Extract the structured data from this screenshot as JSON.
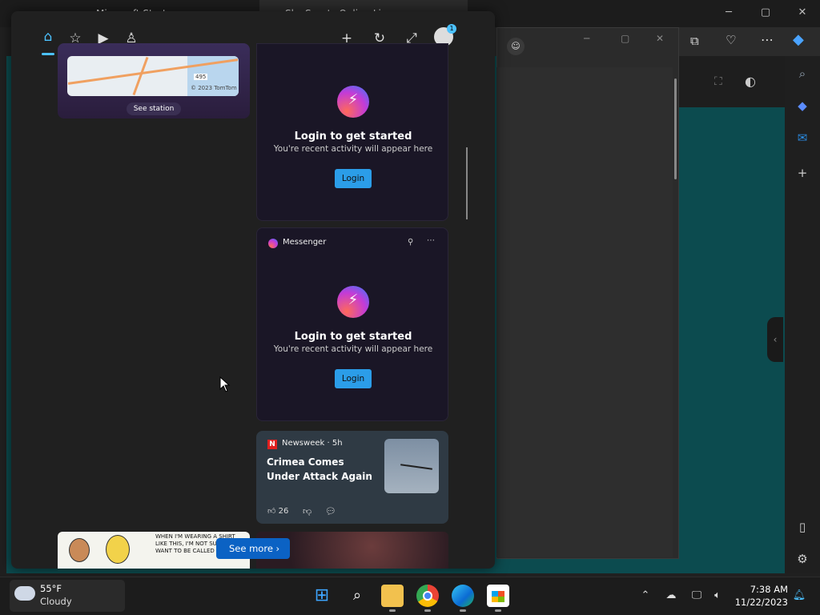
{
  "browser": {
    "tab1_title": "Microsoft Start",
    "tab2_title": "Sky Sports Online Live",
    "minimize": "─",
    "maximize": "▢",
    "close": "✕",
    "toolbar_more": "⋯"
  },
  "widgets": {
    "map_card": {
      "credit": "© 2023 TomTom",
      "road_label": "495",
      "action": "See station"
    },
    "messenger_cards": [
      {
        "title": "Login to get started",
        "subtitle": "You're recent activity will appear here",
        "login_label": "Login"
      },
      {
        "app_name": "Messenger",
        "title": "Login to get started",
        "subtitle": "You're recent activity will appear here",
        "login_label": "Login"
      }
    ],
    "news_card": {
      "source_logo": "N",
      "source": "Newsweek · 5h",
      "title": "Crimea Comes Under Attack Again",
      "likes": "26"
    },
    "comic_text": "WHEN I'M WEARING A SHIRT LIKE THIS, I'M NOT SURE I WANT TO BE CALLED \"HUMPY.\"",
    "see_more_label": "See more ›",
    "header": {
      "badge": "1"
    }
  },
  "taskbar": {
    "weather_temp": "55°F",
    "weather_cond": "Cloudy",
    "time": "7:38 AM",
    "date": "11/22/2023"
  },
  "colors": {
    "accent": "#4cc2ff",
    "login_button": "#2b9de8",
    "see_more": "#0b62c4",
    "page_bg": "#0c4b4f"
  },
  "icons": [
    "home-icon",
    "star-settings-icon",
    "video-icon",
    "people-icon",
    "plus-icon",
    "refresh-icon",
    "expand-icon",
    "avatar-icon",
    "messenger-icon",
    "pin-icon",
    "more-icon",
    "like-icon",
    "dislike-icon",
    "comment-icon",
    "search-icon",
    "start-icon",
    "file-explorer-icon",
    "chrome-icon",
    "edge-icon",
    "store-icon",
    "chevron-up-icon",
    "notification-icon"
  ]
}
